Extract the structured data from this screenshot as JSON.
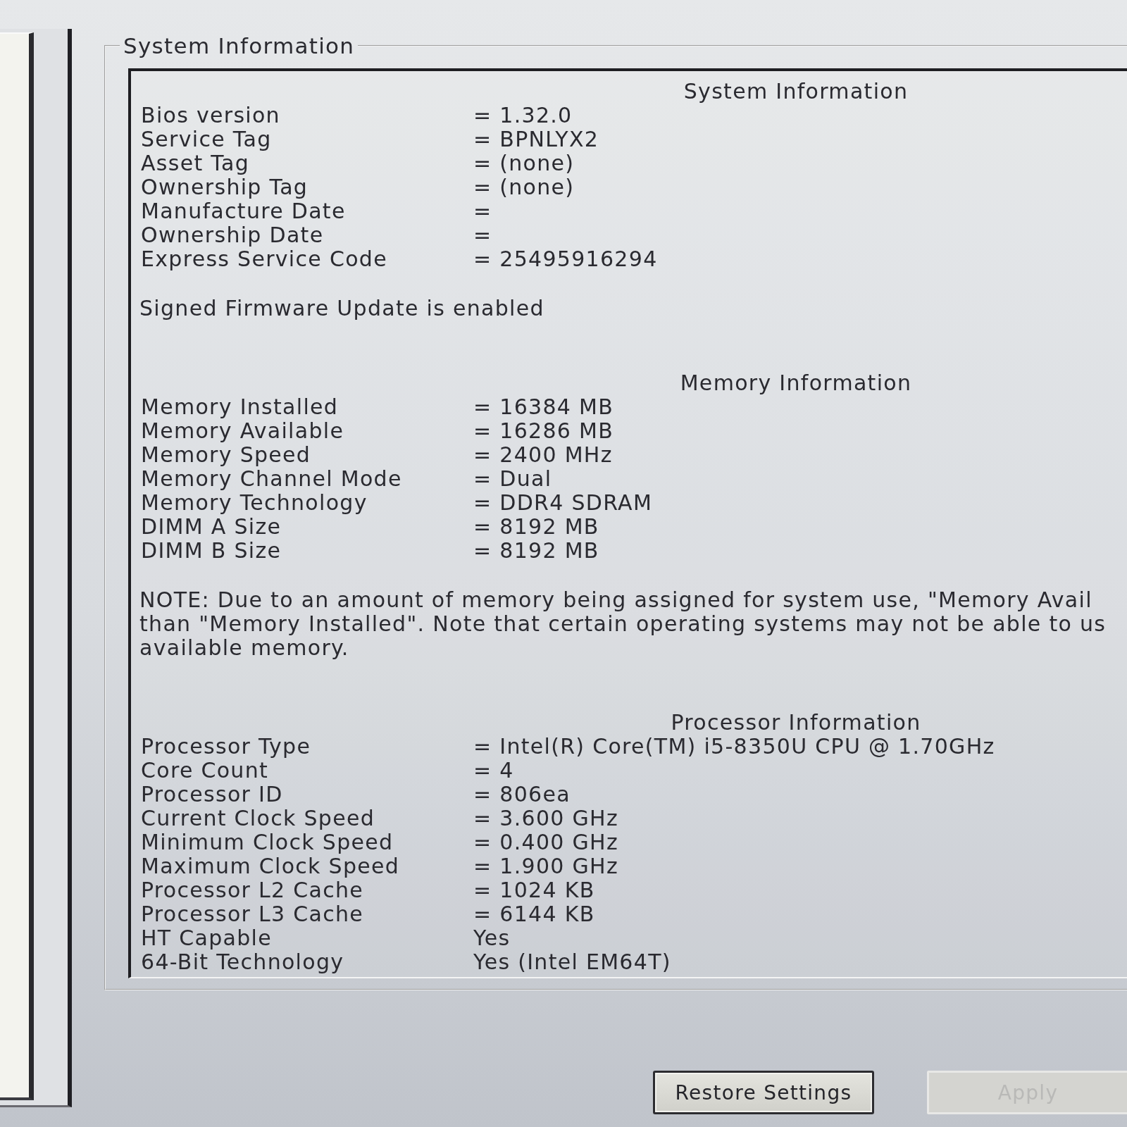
{
  "group_box": {
    "title": "System Information"
  },
  "sections": [
    {
      "heading": "System Information",
      "rows": [
        {
          "label": "Bios version",
          "value": "= 1.32.0"
        },
        {
          "label": "Service Tag",
          "value": "= BPNLYX2"
        },
        {
          "label": "Asset Tag",
          "value": "= (none)"
        },
        {
          "label": "Ownership Tag",
          "value": "= (none)"
        },
        {
          "label": "Manufacture Date",
          "value": "="
        },
        {
          "label": "Ownership Date",
          "value": "="
        },
        {
          "label": "Express Service Code",
          "value": "= 25495916294"
        }
      ],
      "notes": [
        {
          "lines": [
            "Signed Firmware Update is enabled"
          ]
        }
      ]
    },
    {
      "heading": "Memory Information",
      "rows": [
        {
          "label": "Memory Installed",
          "value": "= 16384 MB"
        },
        {
          "label": "Memory Available",
          "value": "= 16286 MB"
        },
        {
          "label": "Memory Speed",
          "value": "= 2400 MHz"
        },
        {
          "label": "Memory Channel Mode",
          "value": "= Dual"
        },
        {
          "label": "Memory Technology",
          "value": "= DDR4 SDRAM"
        },
        {
          "label": "DIMM A Size",
          "value": "= 8192 MB"
        },
        {
          "label": "DIMM B Size",
          "value": "= 8192 MB"
        }
      ],
      "notes": [
        {
          "lines": [
            "NOTE: Due to an amount of memory being assigned for system use, \"Memory Avail",
            "than \"Memory Installed\". Note that certain operating systems may not be able to us",
            "available memory."
          ]
        }
      ]
    },
    {
      "heading": "Processor Information",
      "rows": [
        {
          "label": "Processor Type",
          "value": "= Intel(R) Core(TM) i5-8350U CPU @ 1.70GHz"
        },
        {
          "label": "Core Count",
          "value": "= 4"
        },
        {
          "label": "Processor ID",
          "value": "= 806ea"
        },
        {
          "label": "Current Clock Speed",
          "value": "= 3.600 GHz"
        },
        {
          "label": "Minimum Clock Speed",
          "value": "= 0.400 GHz"
        },
        {
          "label": "Maximum Clock Speed",
          "value": "= 1.900 GHz"
        },
        {
          "label": "Processor L2 Cache",
          "value": "= 1024 KB"
        },
        {
          "label": "Processor L3 Cache",
          "value": "= 6144 KB"
        },
        {
          "label": "HT Capable",
          "value": "Yes"
        },
        {
          "label": "64-Bit Technology",
          "value": "Yes (Intel EM64T)"
        }
      ]
    }
  ],
  "buttons": [
    {
      "label": "Restore Settings",
      "disabled": false
    },
    {
      "label": "Apply",
      "disabled": true
    }
  ]
}
